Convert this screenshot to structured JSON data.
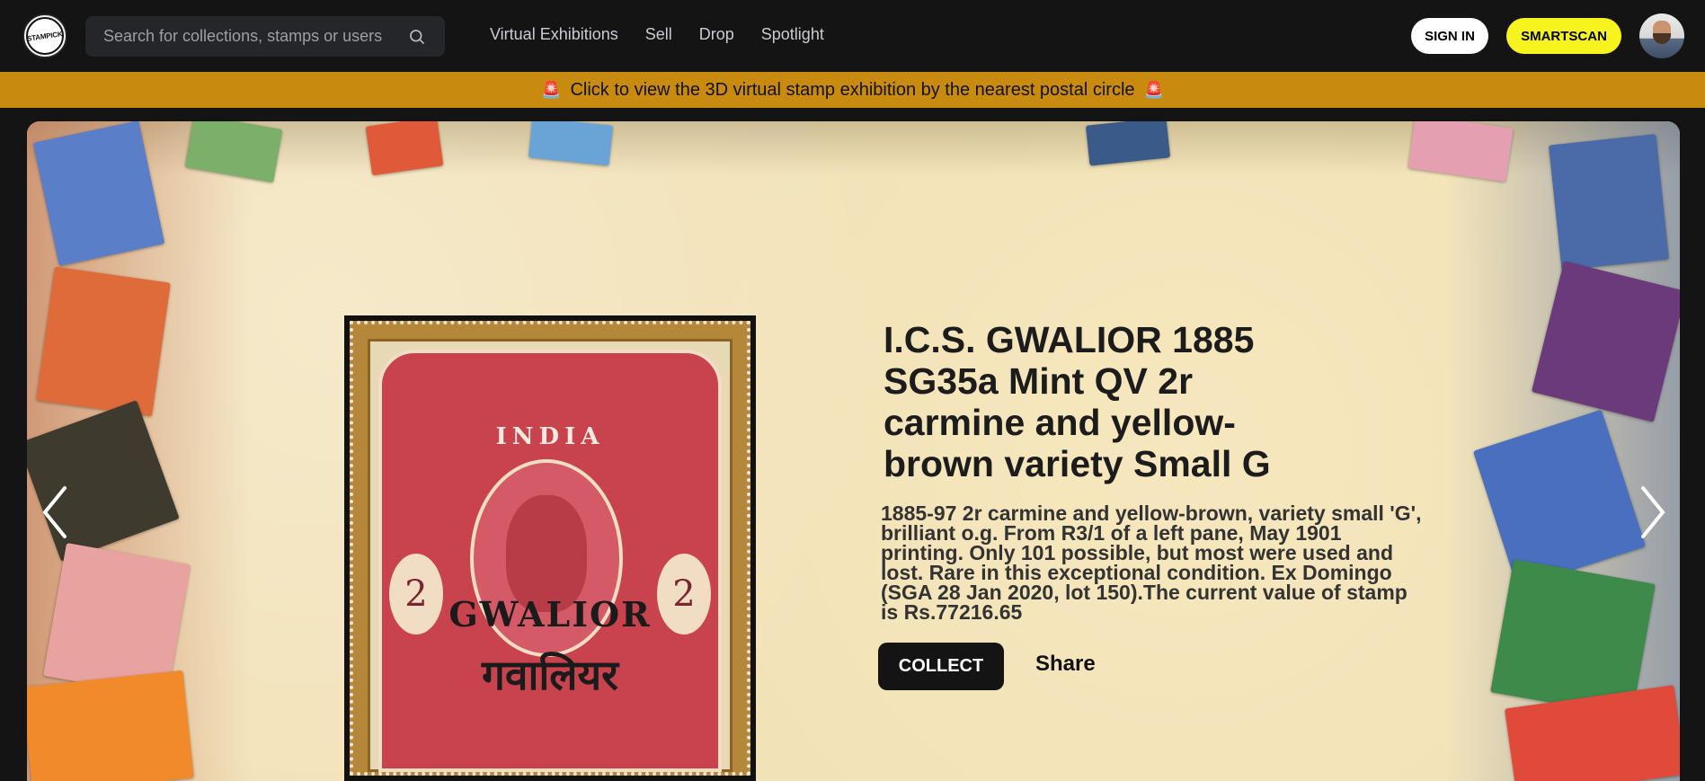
{
  "header": {
    "logo_text": "STAMPICK",
    "search_placeholder": "Search for collections, stamps or users",
    "nav": [
      "Virtual Exhibitions",
      "Sell",
      "Drop",
      "Spotlight"
    ],
    "signin_label": "SIGN IN",
    "smartscan_label": "SMARTSCAN"
  },
  "banner": {
    "text": "Click to view the 3D virtual stamp exhibition by the nearest postal circle",
    "icon": "🚨"
  },
  "hero": {
    "stamp_labels": {
      "country": "INDIA",
      "value": "2",
      "overprint_en": "GWALIOR",
      "overprint_hi": "गवालियर"
    },
    "title": "I.C.S. GWALIOR 1885 SG35a Mint QV 2r carmine and yellow-brown variety Small G",
    "description": "1885-97 2r carmine and yellow-brown, variety small 'G', brilliant o.g. From R3/1 of a left pane, May 1901 printing. Only 101 possible, but most were used and lost. Rare in this exceptional condition. Ex Domingo (SGA 28 Jan 2020, lot 150).The current value of stamp is Rs.77216.65",
    "collect_label": "COLLECT",
    "share_label": "Share"
  },
  "icons": {
    "search": "search-icon",
    "prev": "chevron-left-icon",
    "next": "chevron-right-icon",
    "alarm": "siren-icon"
  },
  "colors": {
    "header_bg": "#141414",
    "banner_bg": "#c98a10",
    "smartscan_bg": "#f7f31e",
    "collect_bg": "#141414"
  }
}
